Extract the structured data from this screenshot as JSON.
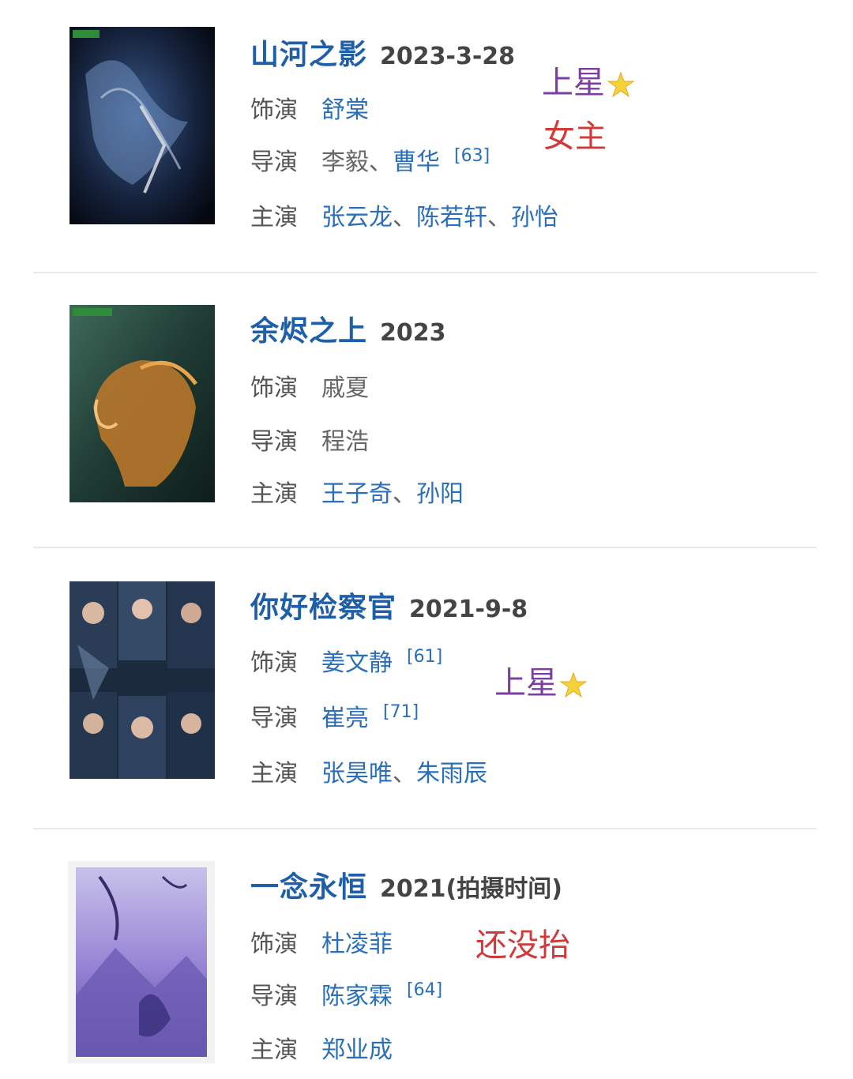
{
  "entries": [
    {
      "title": "山河之影",
      "date": "2023-3-28",
      "role_label": "饰演",
      "role": "舒棠",
      "director_label": "导演",
      "directors": [
        "李毅",
        "曹华"
      ],
      "director_ref": "[63]",
      "cast_label": "主演",
      "cast": [
        "张云龙",
        "陈若轩",
        "孙怡"
      ],
      "notes": [
        "上星",
        "女主"
      ],
      "poster_icon": "dark-blue-drama-poster"
    },
    {
      "title": "余烬之上",
      "date": "2023",
      "role_label": "饰演",
      "role": "戚夏",
      "director_label": "导演",
      "directors": [
        "程浩"
      ],
      "cast_label": "主演",
      "cast": [
        "王子奇",
        "孙阳"
      ],
      "poster_icon": "golden-profile-poster"
    },
    {
      "title": "你好检察官",
      "date": "2021-9-8",
      "role_label": "饰演",
      "role": "姜文静",
      "role_ref": "[61]",
      "director_label": "导演",
      "directors": [
        "崔亮"
      ],
      "director_ref": "[71]",
      "cast_label": "主演",
      "cast": [
        "张昊唯",
        "朱雨辰"
      ],
      "notes": [
        "上星"
      ],
      "poster_icon": "prosecutor-cast-poster"
    },
    {
      "title": "一念永恒",
      "date": "2021(拍摄时间)",
      "role_label": "饰演",
      "role": "杜凌菲",
      "director_label": "导演",
      "directors": [
        "陈家霖"
      ],
      "director_ref": "[64]",
      "cast_label": "主演",
      "cast": [
        "郑业成"
      ],
      "notes": [
        "还没抬"
      ],
      "poster_icon": "purple-fantasy-poster"
    }
  ],
  "separator": "、",
  "colors": {
    "title": "#1f5fa8",
    "link": "#2a6fb8",
    "note_purple": "#7b3fa0",
    "note_red": "#d23a3a"
  }
}
